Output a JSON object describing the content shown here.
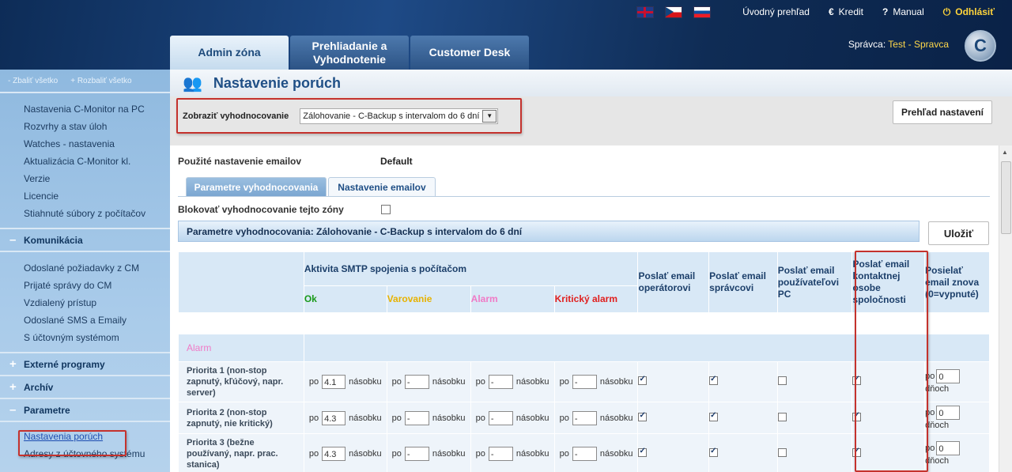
{
  "topbar": {
    "flags": [
      "uk-flag-icon",
      "cz-flag-icon",
      "sk-flag-icon"
    ],
    "home": "Úvodný prehľad",
    "credit": "Kredit",
    "manual": "Manual",
    "logout": "Odhlásiť"
  },
  "user": {
    "label": "Správca:",
    "name": "Test - Spravca"
  },
  "tabs": [
    {
      "label": "Admin zóna"
    },
    {
      "label": "Prehliadanie a Vyhodnotenie"
    },
    {
      "label": "Customer Desk"
    }
  ],
  "sidebar": {
    "collapse_all": "- Zbaliť všetko",
    "expand_all": "+ Rozbaliť všetko",
    "items_top": [
      "Nastavenia C-Monitor na PC",
      "Rozvrhy a stav úloh",
      "Watches - nastavenia",
      "Aktualizácia C-Monitor kl.",
      "Verzie",
      "Licencie",
      "Stiahnuté súbory z počítačov"
    ],
    "comm_head": "Komunikácia",
    "comm_items": [
      "Odoslané požiadavky z CM",
      "Prijaté správy do CM",
      "Vzdialený prístup",
      "Odoslané SMS a Emaily",
      "S účtovným systémom"
    ],
    "ext_head": "Externé programy",
    "arch_head": "Archív",
    "param_head": "Parametre",
    "param_items": [
      "Nastavenia porúch",
      "Adresy z účtovného systému"
    ]
  },
  "page": {
    "title": "Nastavenie porúch",
    "filter_label": "Zobraziť vyhodnocovanie",
    "filter_value": "Zálohovanie - C-Backup s intervalom do 6 dní",
    "overview_button": "Prehľad nastavení",
    "email_label": "Použité nastavenie emailov",
    "email_value": "Default",
    "subtab_params": "Parametre vyhodnocovania",
    "subtab_email": "Nastavenie emailov",
    "block_label": "Blokovať vyhodnocovanie tejto zóny",
    "param_header": "Parametre vyhodnocovania: Zálohovanie - C-Backup s intervalom do 6 dní",
    "save_button": "Uložiť"
  },
  "grid": {
    "smtp_header": "Aktivita SMTP spojenia s počítačom",
    "states": {
      "ok": "Ok",
      "warn": "Varovanie",
      "alarm": "Alarm",
      "crit": "Kritický alarm"
    },
    "col_operators": "Poslať email operátorovi",
    "col_admin": "Poslať email správcovi",
    "col_pcuser": "Poslať email používateľovi PC",
    "col_contact": "Poslať email kontaktnej osobe spoločnosti",
    "col_repeat": "Posielať email znova (0=vypnuté)",
    "section": "Alarm",
    "po": "po",
    "nasobku": "násobku",
    "dnoch": "dňoch",
    "rows": [
      {
        "name": "Priorita 1 (non-stop zapnutý, kľúčový, napr. server)",
        "ok": "4.1",
        "warn": "-",
        "alarm": "-",
        "crit": "-",
        "op": true,
        "adm": true,
        "pc": false,
        "contact": true,
        "repeat": "0"
      },
      {
        "name": "Priorita 2 (non-stop zapnutý, nie kritický)",
        "ok": "4.3",
        "warn": "-",
        "alarm": "-",
        "crit": "-",
        "op": true,
        "adm": true,
        "pc": false,
        "contact": true,
        "repeat": "0"
      },
      {
        "name": "Priorita 3 (bežne používaný, napr. prac. stanica)",
        "ok": "4.3",
        "warn": "-",
        "alarm": "-",
        "crit": "-",
        "op": true,
        "adm": true,
        "pc": false,
        "contact": true,
        "repeat": "0"
      }
    ]
  }
}
